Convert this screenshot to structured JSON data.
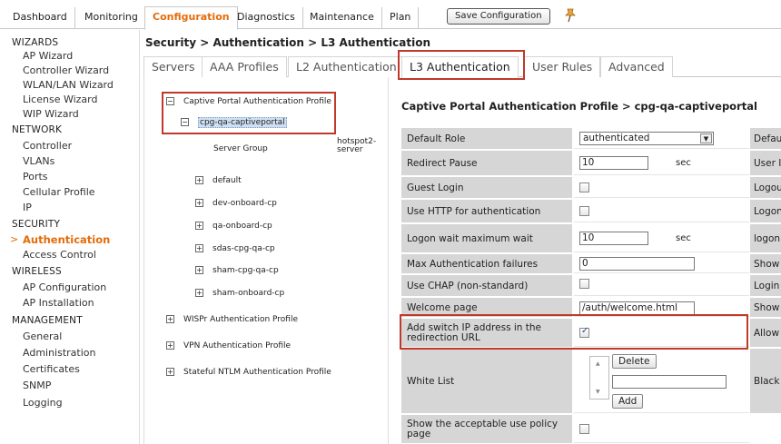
{
  "topnav": {
    "tabs": [
      "Dashboard",
      "Monitoring",
      "Configuration",
      "Diagnostics",
      "Maintenance",
      "Plan"
    ],
    "active": "Configuration",
    "save_label": "Save Configuration"
  },
  "sidebar": {
    "wizards_header": "WIZARDS",
    "wizards": [
      "AP Wizard",
      "Controller Wizard",
      "WLAN/LAN Wizard",
      "License Wizard",
      "WIP Wizard"
    ],
    "network_header": "NETWORK",
    "network": [
      "Controller",
      "VLANs",
      "Ports",
      "Cellular Profile",
      "IP"
    ],
    "security_header": "SECURITY",
    "security": [
      "Authentication",
      "Access Control"
    ],
    "wireless_header": "WIRELESS",
    "wireless": [
      "AP Configuration",
      "AP Installation"
    ],
    "management_header": "MANAGEMENT",
    "management": [
      "General",
      "Administration",
      "Certificates",
      "SNMP",
      "Logging"
    ],
    "active_item": "Authentication",
    "active_arrow": ">"
  },
  "breadcrumb": "Security > Authentication > L3 Authentication",
  "subtabs": [
    "Servers",
    "AAA Profiles",
    "L2 Authentication",
    "L3 Authentication",
    "User Rules",
    "Advanced"
  ],
  "tree": {
    "root": "Captive Portal Authentication Profile",
    "selected": "cpg-qa-captiveportal",
    "server_group_label": "Server Group",
    "server_group_value_1": "hotspot2-",
    "server_group_value_2": "server",
    "profiles": [
      "default",
      "dev-onboard-cp",
      "qa-onboard-cp",
      "sdas-cpg-qa-cp",
      "sham-cpg-qa-cp",
      "sham-onboard-cp"
    ],
    "other_roots": [
      "WISPr Authentication Profile",
      "VPN Authentication Profile",
      "Stateful NTLM Authentication Profile"
    ]
  },
  "panel": {
    "title": "Captive Portal Authentication Profile > cpg-qa-captiveportal",
    "default_role_label": "Default Role",
    "default_role_value": "authenticated",
    "redirect_pause_label": "Redirect Pause",
    "redirect_pause_value": "10",
    "sec_unit": "sec",
    "guest_login_label": "Guest Login",
    "use_http_label": "Use HTTP for authentication",
    "logon_wait_label": "Logon wait maximum wait",
    "logon_wait_value": "10",
    "max_auth_label": "Max Authentication failures",
    "max_auth_value": "0",
    "use_chap_label": "Use CHAP (non-standard)",
    "welcome_label": "Welcome page",
    "welcome_value": "/auth/welcome.html",
    "add_switch_ip_label": "Add switch IP address in the redirection URL",
    "add_switch_ip_checked": true,
    "white_list_label": "White List",
    "delete_label": "Delete",
    "add_label": "Add",
    "show_aup_label": "Show the acceptable use policy page",
    "right_col": [
      "Defau",
      "User I",
      "Logou",
      "Logon",
      "logon thresh",
      "Show",
      "Login",
      "Show",
      "Allow sessio",
      "Black"
    ]
  }
}
